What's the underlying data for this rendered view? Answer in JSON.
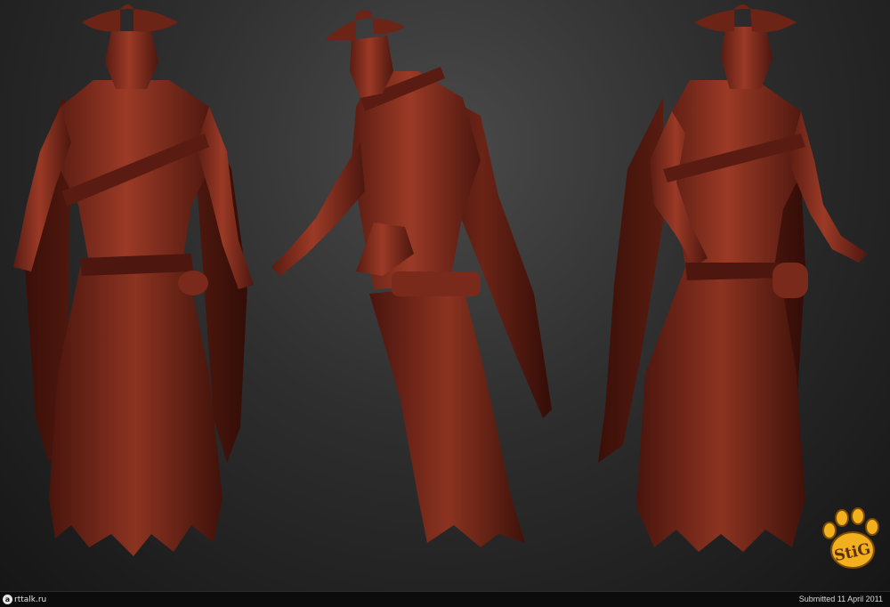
{
  "scene": {
    "background_colors": [
      "#4a4a4a",
      "#161616"
    ],
    "figure_color": "#8a2f1f",
    "figures": [
      {
        "view": "front",
        "name": "figure-front-view"
      },
      {
        "view": "side",
        "name": "figure-side-view"
      },
      {
        "view": "three-quarter",
        "name": "figure-three-quarter-view"
      }
    ]
  },
  "watermark": {
    "text": "StiG",
    "color": "#f2b01c",
    "icon": "bear-paw-icon"
  },
  "footer": {
    "logo_mark": "a",
    "site_name": "rttalk.ru",
    "submitted": "Submitted 11 April 2011"
  }
}
